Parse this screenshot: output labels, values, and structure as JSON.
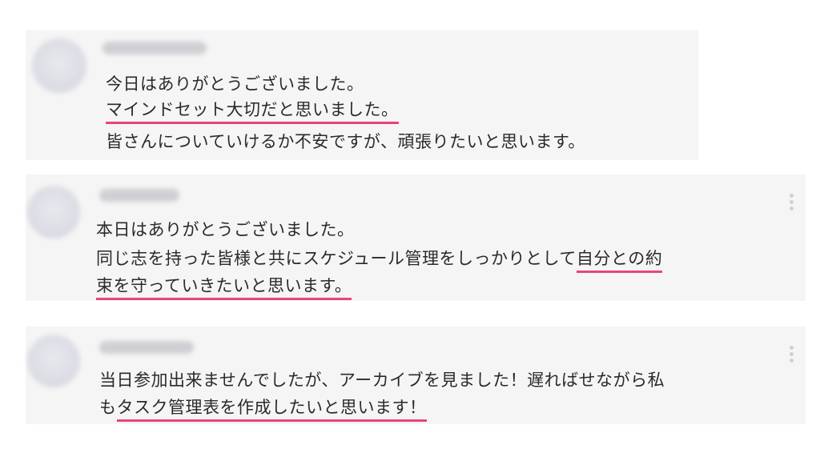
{
  "comments": [
    {
      "lines": [
        [
          "今日はありがとうございました。"
        ],
        [
          "マインドセット大切だと思いました。"
        ],
        [
          "皆さんについていけるか不安ですが、頑張りたいと思います。"
        ]
      ]
    },
    {
      "lines": [
        [
          "本日はありがとうございました。"
        ],
        [
          "同じ志を持った皆様と共にスケジュール管理をしっかりとして",
          "自分との約"
        ],
        [
          "束を守っていきたいと思います。"
        ]
      ]
    },
    {
      "lines": [
        [
          "当日参加出来ませんでしたが、アーカイブを見ました！遅ればせながら私"
        ],
        [
          "も",
          "タスク管理表を作成したいと思います！"
        ]
      ]
    }
  ],
  "colors": {
    "underline": "#e8447a",
    "card_bg": "#f5f5f5"
  }
}
